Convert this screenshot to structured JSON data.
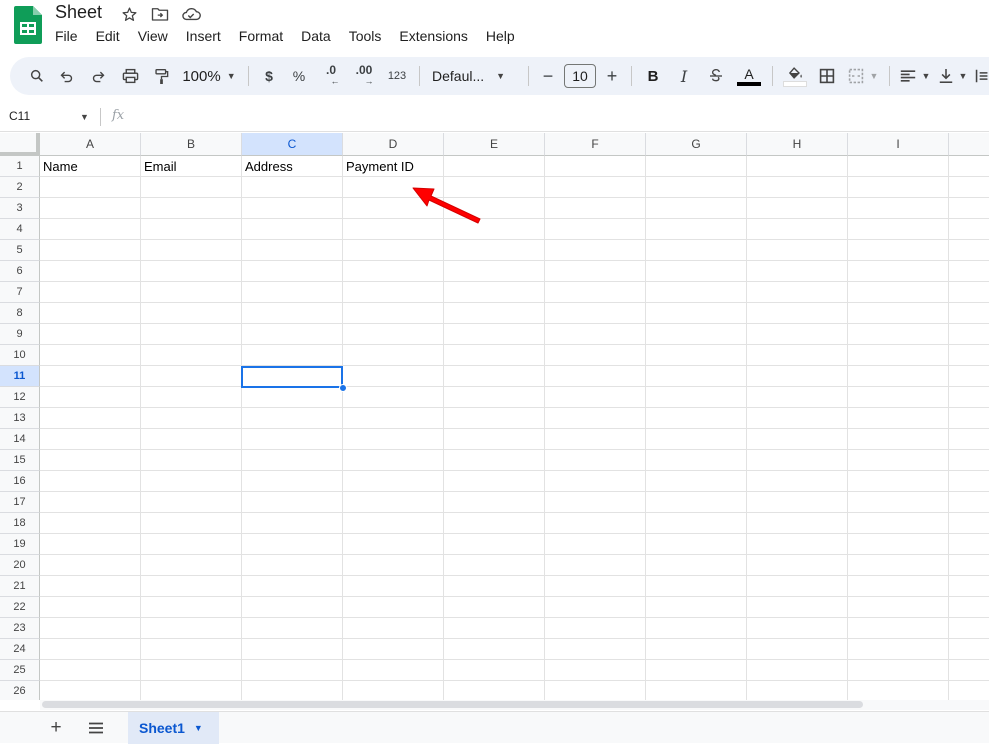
{
  "doc": {
    "title": "Sheet"
  },
  "menu": [
    "File",
    "Edit",
    "View",
    "Insert",
    "Format",
    "Data",
    "Tools",
    "Extensions",
    "Help"
  ],
  "toolbar": {
    "zoom": "100%",
    "currency": "$",
    "percent": "%",
    "decrease_decimal": ".0",
    "increase_decimal": ".00",
    "number_format": "123",
    "font": "Defaul...",
    "font_size": "10",
    "bold": "B",
    "italic": "I",
    "text_color_letter": "A"
  },
  "formula_bar": {
    "cell_ref": "C11",
    "fx": "fx",
    "value": ""
  },
  "grid": {
    "columns": [
      "A",
      "B",
      "C",
      "D",
      "E",
      "F",
      "G",
      "H",
      "I"
    ],
    "rows": [
      "1",
      "2",
      "3",
      "4",
      "5",
      "6",
      "7",
      "8",
      "9",
      "10",
      "11",
      "12",
      "13",
      "14",
      "15",
      "16",
      "17",
      "18",
      "19",
      "20",
      "21",
      "22",
      "23",
      "24",
      "25",
      "26"
    ],
    "selected_column": "C",
    "selected_row": "11",
    "row1": [
      "Name",
      "Email",
      "Address",
      "Payment ID"
    ]
  },
  "annotation": {
    "arrow_color": "#ff0000"
  },
  "sheets": {
    "active": "Sheet1"
  },
  "colors": {
    "accent": "#1a73e8",
    "selected_header": "#d3e3fd",
    "toolbar_bg": "#eef2f9",
    "sheets_green": "#0f9d58"
  }
}
